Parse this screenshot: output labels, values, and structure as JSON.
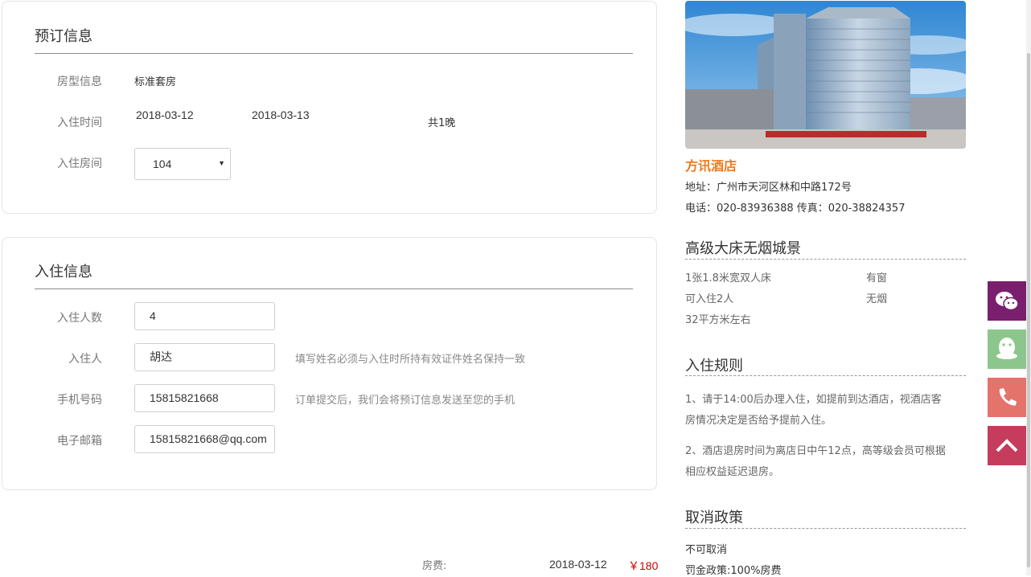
{
  "booking": {
    "title": "预订信息",
    "room_type_label": "房型信息",
    "room_type_value": "标准套房",
    "checkin_label": "入住时间",
    "checkin_date": "2018-03-12",
    "checkout_date": "2018-03-13",
    "nights": "共1晚",
    "room_label": "入住房间",
    "room_selected": "104"
  },
  "guest": {
    "title": "入住信息",
    "count_label": "入住人数",
    "count_value": "4",
    "name_label": "入住人",
    "name_value": "胡达",
    "name_hint": "填写姓名必须与入住时所持有效证件姓名保持一致",
    "phone_label": "手机号码",
    "phone_value": "15815821668",
    "phone_hint": "订单提交后，我们会将预订信息发送至您的手机",
    "email_label": "电子邮箱",
    "email_value": "15815821668@qq.com"
  },
  "fee": {
    "label": "房费:",
    "date": "2018-03-12",
    "amount": "￥180"
  },
  "hotel": {
    "name": "方讯酒店",
    "address": "地址：广州市天河区林和中路172号",
    "contact": "电话：020-83936388 传真：020-38824357"
  },
  "room_features": {
    "title": "高级大床无烟城景",
    "bed": "1张1.8米宽双人床",
    "window": "有窗",
    "capacity": "可入住2人",
    "smoke": "无烟",
    "area": "32平方米左右"
  },
  "rules": {
    "title": "入住规则",
    "rule1_line1": "1、请于14:00后办理入住，如提前到达酒店，视酒店客",
    "rule1_line2": "房情况决定是否给予提前入住。",
    "rule2_line1": "2、酒店退房时间为离店日中午12点，高等级会员可根据",
    "rule2_line2": "相应权益延迟退房。"
  },
  "cancel": {
    "title": "取消政策",
    "policy": "不可取消",
    "penalty": "罚金政策:100%房费"
  },
  "float_buttons": [
    {
      "icon": "wechat-icon",
      "color": "#7a1e6e"
    },
    {
      "icon": "qq-icon",
      "color": "#8dc68d"
    },
    {
      "icon": "phone-icon",
      "color": "#e3736b"
    },
    {
      "icon": "back-to-top-icon",
      "color": "#c63c5c"
    }
  ],
  "colors": {
    "accent": "#f07a1a",
    "price": "#cc0000"
  }
}
